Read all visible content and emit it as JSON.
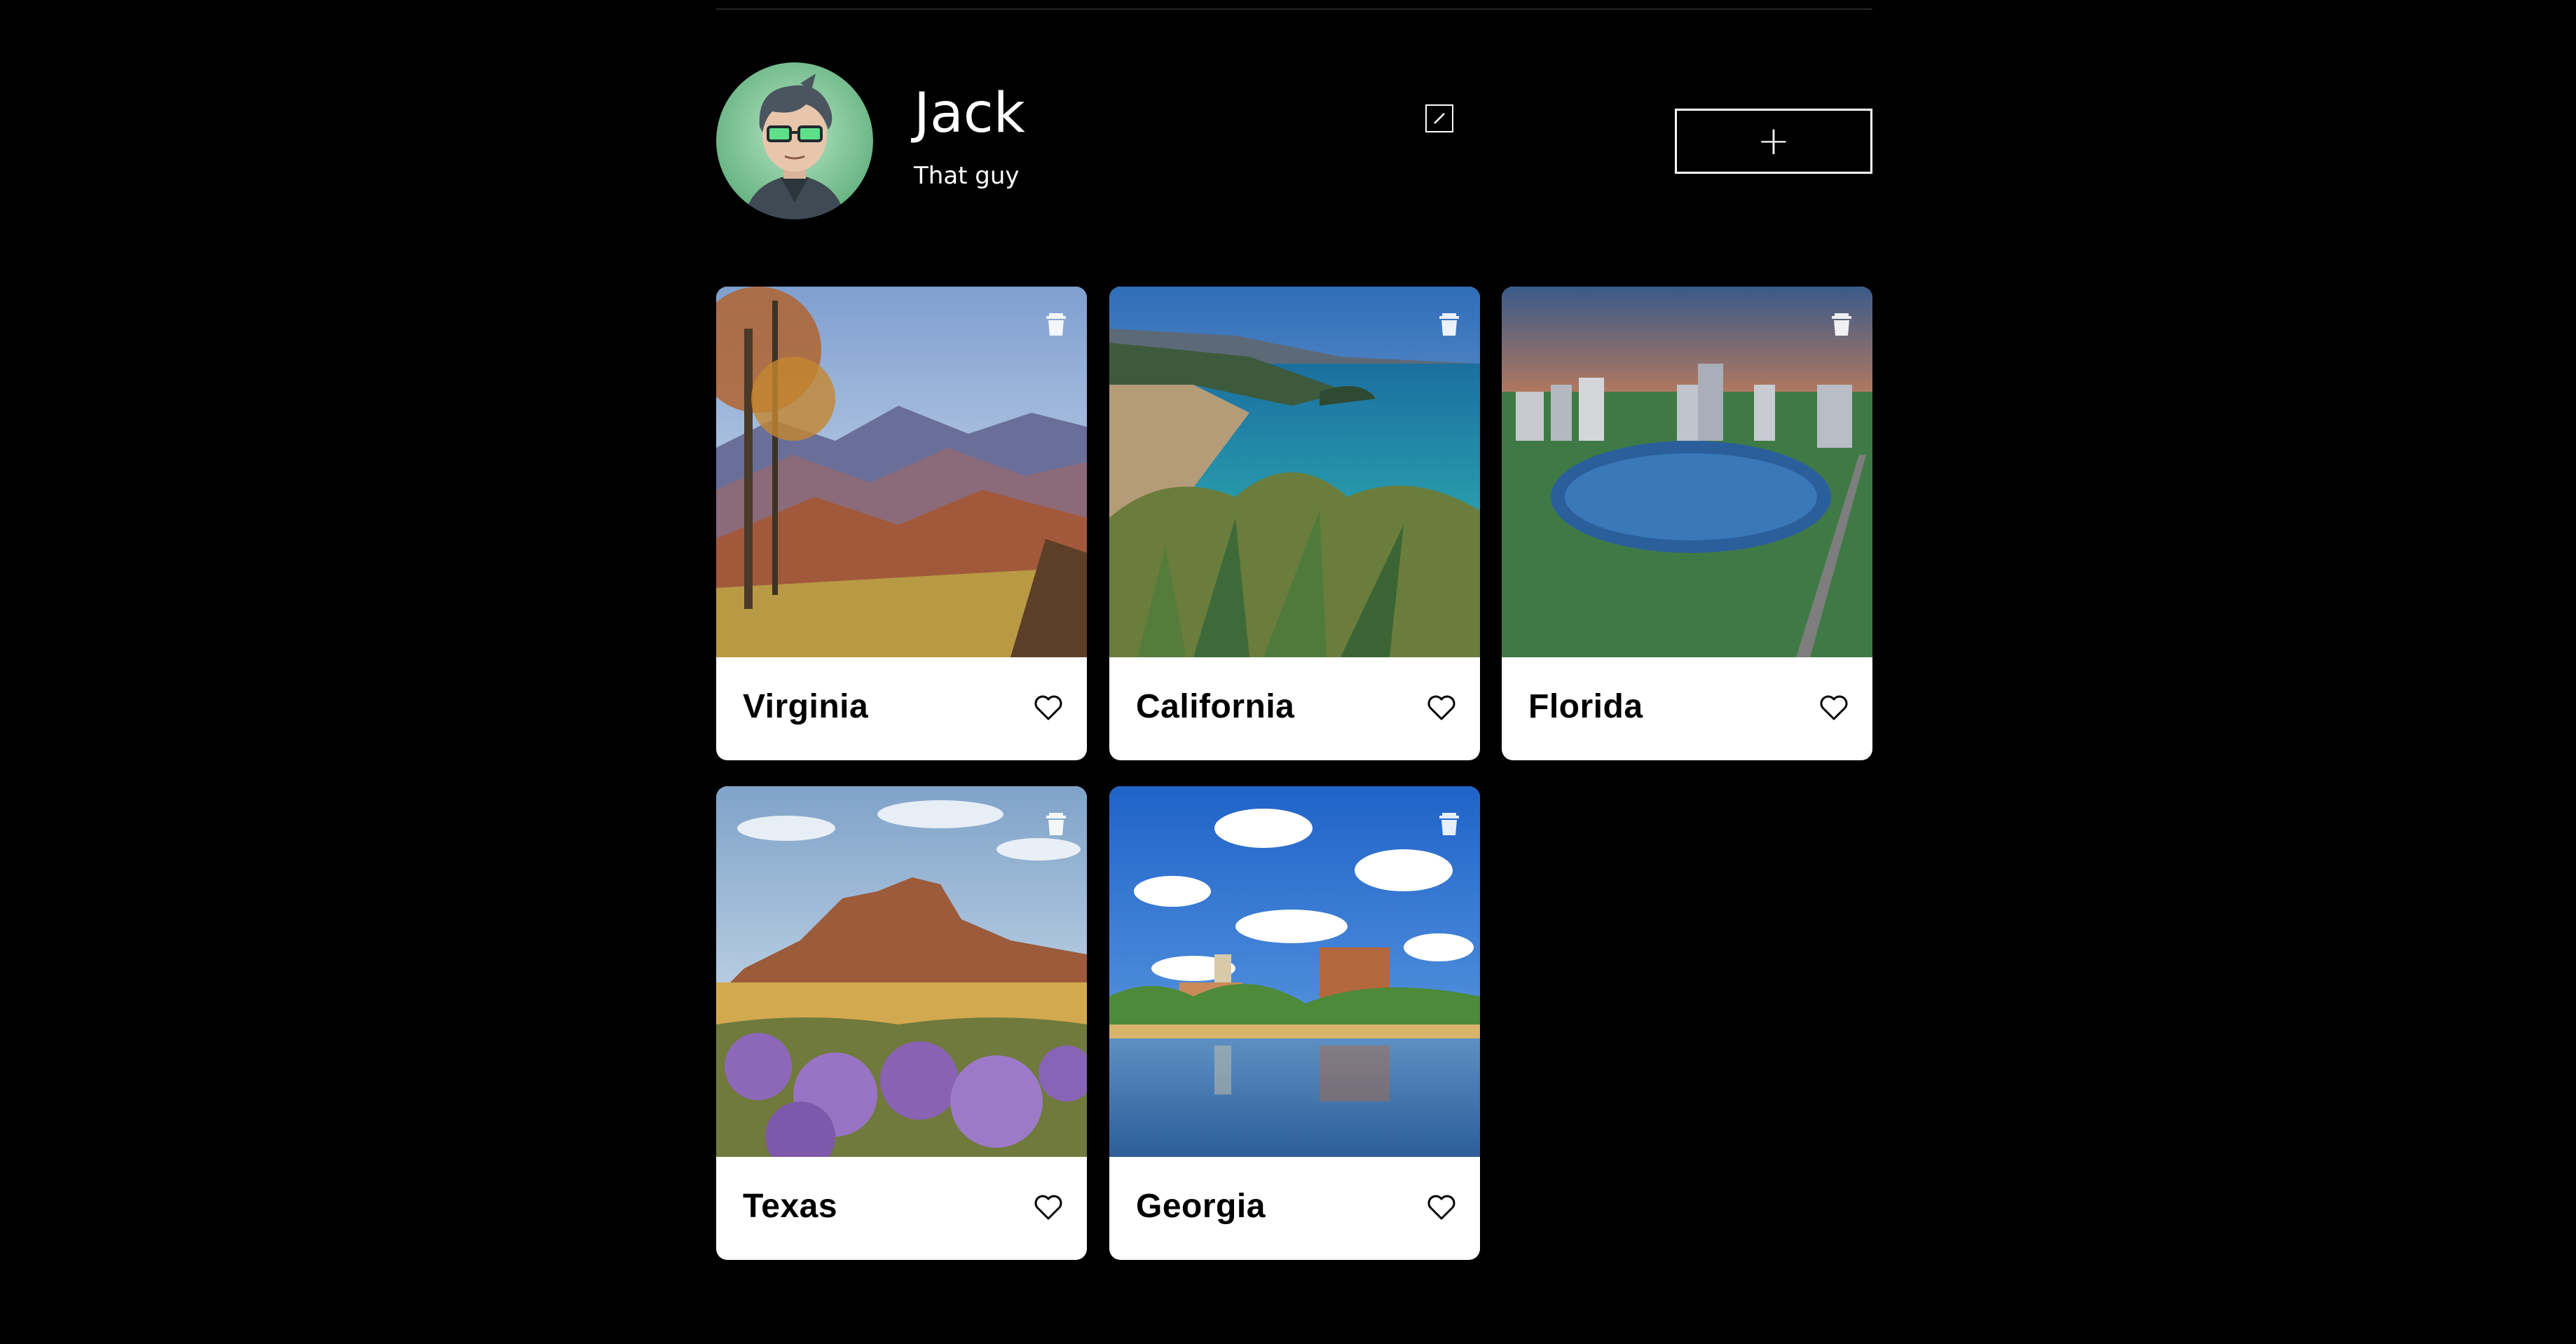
{
  "colors": {
    "background": "#000000",
    "text": "#ffffff",
    "card_background": "#ffffff",
    "card_title": "#000000",
    "avatar_ring": "#6fbf8e"
  },
  "profile": {
    "name": "Jack",
    "description": "That guy",
    "edit_icon": "pencil-edit-icon",
    "add_label": "+",
    "add_icon": "plus-icon"
  },
  "cards": [
    {
      "title": "Virginia",
      "image": "autumn-mountains-photo",
      "delete_icon": "trash-icon",
      "like_icon": "heart-outline-icon"
    },
    {
      "title": "California",
      "image": "coastal-beach-photo",
      "delete_icon": "trash-icon",
      "like_icon": "heart-outline-icon"
    },
    {
      "title": "Florida",
      "image": "city-lake-sunset-photo",
      "delete_icon": "trash-icon",
      "like_icon": "heart-outline-icon"
    },
    {
      "title": "Texas",
      "image": "desert-mesa-wildflowers-photo",
      "delete_icon": "trash-icon",
      "like_icon": "heart-outline-icon"
    },
    {
      "title": "Georgia",
      "image": "riverside-city-clouds-photo",
      "delete_icon": "trash-icon",
      "like_icon": "heart-outline-icon"
    }
  ]
}
